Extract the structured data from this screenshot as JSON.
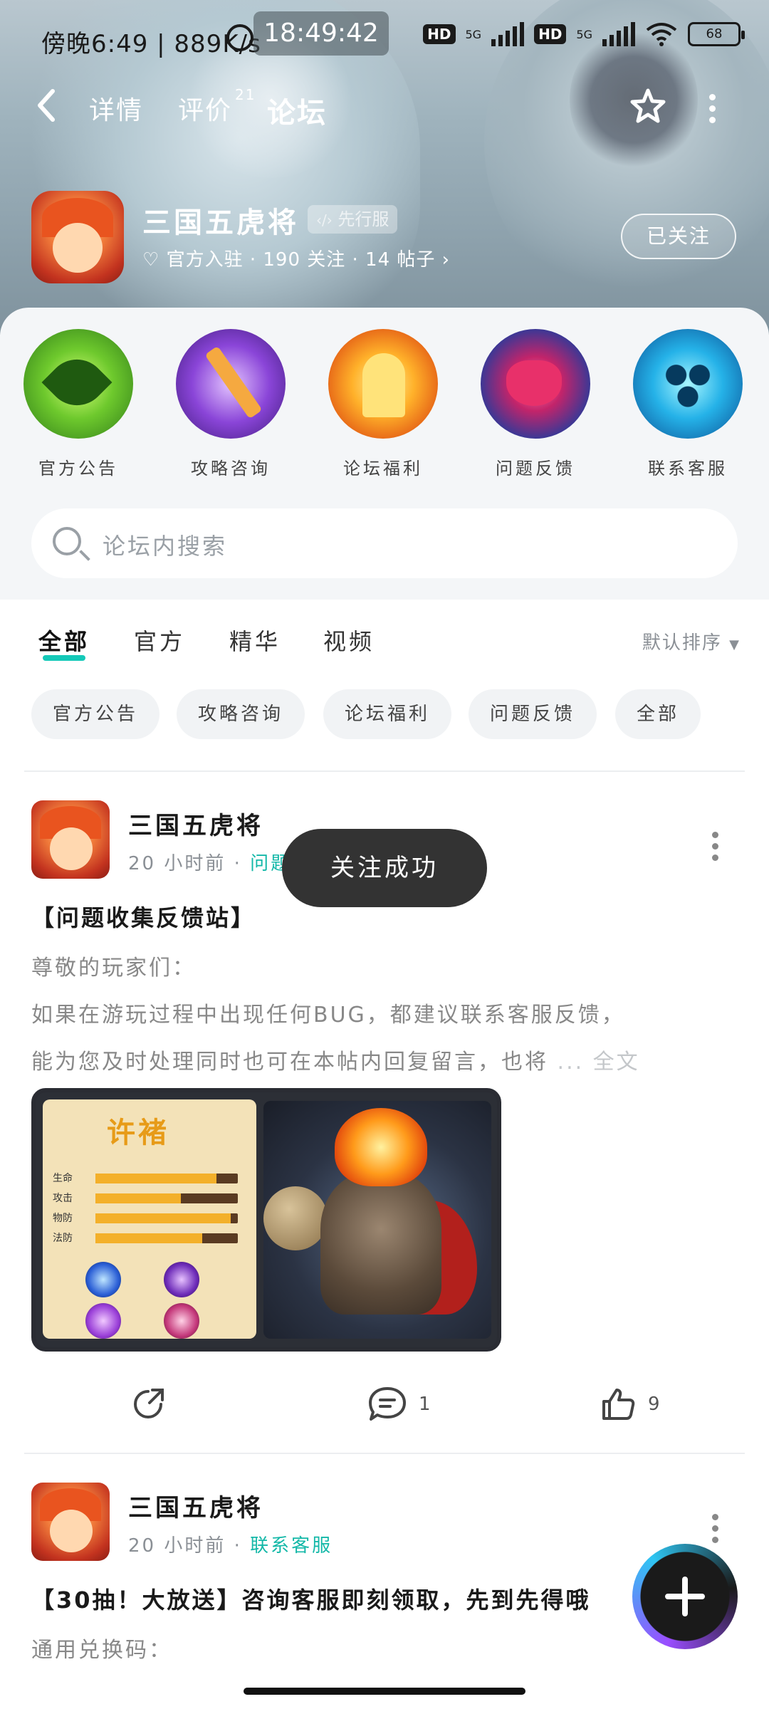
{
  "status_bar": {
    "left_text": "傍晚6:49 | 889K/s",
    "clock": "18:49:42",
    "hd1": "HD",
    "net1": "5G",
    "hd2": "HD",
    "net2": "5G",
    "battery": "68"
  },
  "nav": {
    "tabs": [
      {
        "label": "详情"
      },
      {
        "label": "评价",
        "count": "21"
      },
      {
        "label": "论坛"
      }
    ]
  },
  "game": {
    "name": "三国五虎将",
    "badge": "先行服",
    "meta": "官方入驻 · 190 关注 · 14 帖子 ›",
    "follow_label": "已关注"
  },
  "categories": [
    {
      "label": "官方公告"
    },
    {
      "label": "攻略咨询"
    },
    {
      "label": "论坛福利"
    },
    {
      "label": "问题反馈"
    },
    {
      "label": "联系客服"
    }
  ],
  "search": {
    "placeholder": "论坛内搜索"
  },
  "filter_tabs": [
    {
      "label": "全部"
    },
    {
      "label": "官方"
    },
    {
      "label": "精华"
    },
    {
      "label": "视频"
    }
  ],
  "sort_label": "默认排序",
  "chips": [
    {
      "label": "官方公告"
    },
    {
      "label": "攻略咨询"
    },
    {
      "label": "论坛福利"
    },
    {
      "label": "问题反馈"
    },
    {
      "label": "全部"
    }
  ],
  "posts": [
    {
      "author": "三国五虎将",
      "time": "20 小时前",
      "sep": "·",
      "tag": "问题",
      "title": "【问题收集反馈站】",
      "body_line1": "尊敬的玩家们：",
      "body_line2": " 如果在游玩过程中出现任何BUG，都建议联系客服反馈，",
      "body_line3": "能为您及时处理同时也可在本帖内回复留言，也将",
      "more_text": " ... 全文",
      "image": {
        "hero_name": "许褚",
        "stats": [
          {
            "label": "生命",
            "value": 0.85
          },
          {
            "label": "攻击",
            "value": 0.6
          },
          {
            "label": "物防",
            "value": 0.95
          },
          {
            "label": "法防",
            "value": 0.75
          }
        ]
      },
      "comments": "1",
      "likes": "9"
    },
    {
      "author": "三国五虎将",
      "time": "20 小时前",
      "sep": "·",
      "tag": "联系客服",
      "title": "【30抽！大放送】咨询客服即刻领取，先到先得哦",
      "body_line1": "通用兑换码："
    }
  ],
  "toast": "关注成功",
  "colors": {
    "accent": "#14c9b8",
    "toast_bg": "#333333"
  }
}
